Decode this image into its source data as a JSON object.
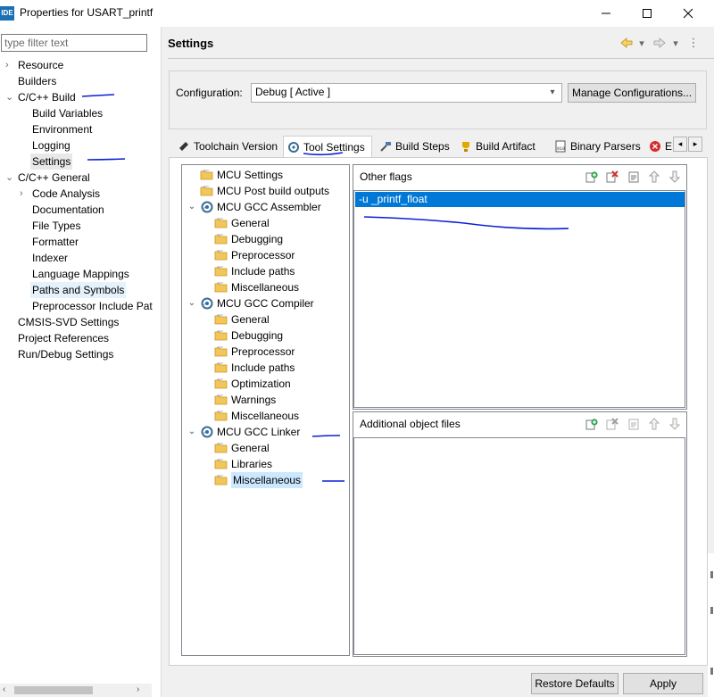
{
  "window": {
    "app_icon_text": "IDE",
    "title": "Properties for USART_printf",
    "controls": [
      "minimize",
      "maximize",
      "close"
    ]
  },
  "filter": {
    "placeholder": "type filter text",
    "value": ""
  },
  "nav": {
    "items": [
      {
        "label": "Resource",
        "indent": 0,
        "chevron": "closed"
      },
      {
        "label": "Builders",
        "indent": 0,
        "chevron": "none"
      },
      {
        "label": "C/C++ Build",
        "indent": 0,
        "chevron": "open"
      },
      {
        "label": "Build Variables",
        "indent": 1,
        "chevron": "none"
      },
      {
        "label": "Environment",
        "indent": 1,
        "chevron": "none"
      },
      {
        "label": "Logging",
        "indent": 1,
        "chevron": "none"
      },
      {
        "label": "Settings",
        "indent": 1,
        "chevron": "none",
        "selected": true
      },
      {
        "label": "C/C++ General",
        "indent": 0,
        "chevron": "open"
      },
      {
        "label": "Code Analysis",
        "indent": 1,
        "chevron": "closed"
      },
      {
        "label": "Documentation",
        "indent": 1,
        "chevron": "none"
      },
      {
        "label": "File Types",
        "indent": 1,
        "chevron": "none"
      },
      {
        "label": "Formatter",
        "indent": 1,
        "chevron": "none"
      },
      {
        "label": "Indexer",
        "indent": 1,
        "chevron": "none"
      },
      {
        "label": "Language Mappings",
        "indent": 1,
        "chevron": "none"
      },
      {
        "label": "Paths and Symbols",
        "indent": 1,
        "chevron": "none",
        "hover": true
      },
      {
        "label": "Preprocessor Include Pat",
        "indent": 1,
        "chevron": "none"
      },
      {
        "label": "CMSIS-SVD Settings",
        "indent": 0,
        "chevron": "none"
      },
      {
        "label": "Project References",
        "indent": 0,
        "chevron": "none"
      },
      {
        "label": "Run/Debug Settings",
        "indent": 0,
        "chevron": "none"
      }
    ]
  },
  "header": {
    "title": "Settings"
  },
  "configuration": {
    "label": "Configuration:",
    "value": "Debug  [ Active ]",
    "manage_button": "Manage Configurations..."
  },
  "tabs": [
    {
      "label": "Toolchain Version",
      "icon": "chip-icon"
    },
    {
      "label": "Tool Settings",
      "icon": "gear-icon",
      "active": true
    },
    {
      "label": "Build Steps",
      "icon": "hammer-icon"
    },
    {
      "label": "Build Artifact",
      "icon": "trophy-icon"
    },
    {
      "label": "Binary Parsers",
      "icon": "binary-icon"
    },
    {
      "label": "E",
      "icon": "error-icon"
    }
  ],
  "tool_tree": [
    {
      "label": "MCU Settings",
      "level": 0,
      "icon": "folder",
      "twist": "none"
    },
    {
      "label": "MCU Post build outputs",
      "level": 0,
      "icon": "folder",
      "twist": "none"
    },
    {
      "label": "MCU GCC Assembler",
      "level": 0,
      "icon": "gear",
      "twist": "open"
    },
    {
      "label": "General",
      "level": 1,
      "icon": "folder"
    },
    {
      "label": "Debugging",
      "level": 1,
      "icon": "folder"
    },
    {
      "label": "Preprocessor",
      "level": 1,
      "icon": "folder"
    },
    {
      "label": "Include paths",
      "level": 1,
      "icon": "folder"
    },
    {
      "label": "Miscellaneous",
      "level": 1,
      "icon": "folder"
    },
    {
      "label": "MCU GCC Compiler",
      "level": 0,
      "icon": "gear",
      "twist": "open"
    },
    {
      "label": "General",
      "level": 1,
      "icon": "folder"
    },
    {
      "label": "Debugging",
      "level": 1,
      "icon": "folder"
    },
    {
      "label": "Preprocessor",
      "level": 1,
      "icon": "folder"
    },
    {
      "label": "Include paths",
      "level": 1,
      "icon": "folder"
    },
    {
      "label": "Optimization",
      "level": 1,
      "icon": "folder"
    },
    {
      "label": "Warnings",
      "level": 1,
      "icon": "folder"
    },
    {
      "label": "Miscellaneous",
      "level": 1,
      "icon": "folder"
    },
    {
      "label": "MCU GCC Linker",
      "level": 0,
      "icon": "gear",
      "twist": "open"
    },
    {
      "label": "General",
      "level": 1,
      "icon": "folder"
    },
    {
      "label": "Libraries",
      "level": 1,
      "icon": "folder"
    },
    {
      "label": "Miscellaneous",
      "level": 1,
      "icon": "folder",
      "selected": true
    }
  ],
  "other_flags": {
    "title": "Other flags",
    "items": [
      "-u _printf_float"
    ]
  },
  "additional_object_files": {
    "title": "Additional object files",
    "items": []
  },
  "buttons": {
    "restore_defaults": "Restore Defaults",
    "apply": "Apply"
  },
  "colors": {
    "selection": "#0078d7",
    "tree_selection": "#cce8ff",
    "annotation_ink": "#0b1fd6",
    "panel_bg": "#f0f0f0"
  }
}
